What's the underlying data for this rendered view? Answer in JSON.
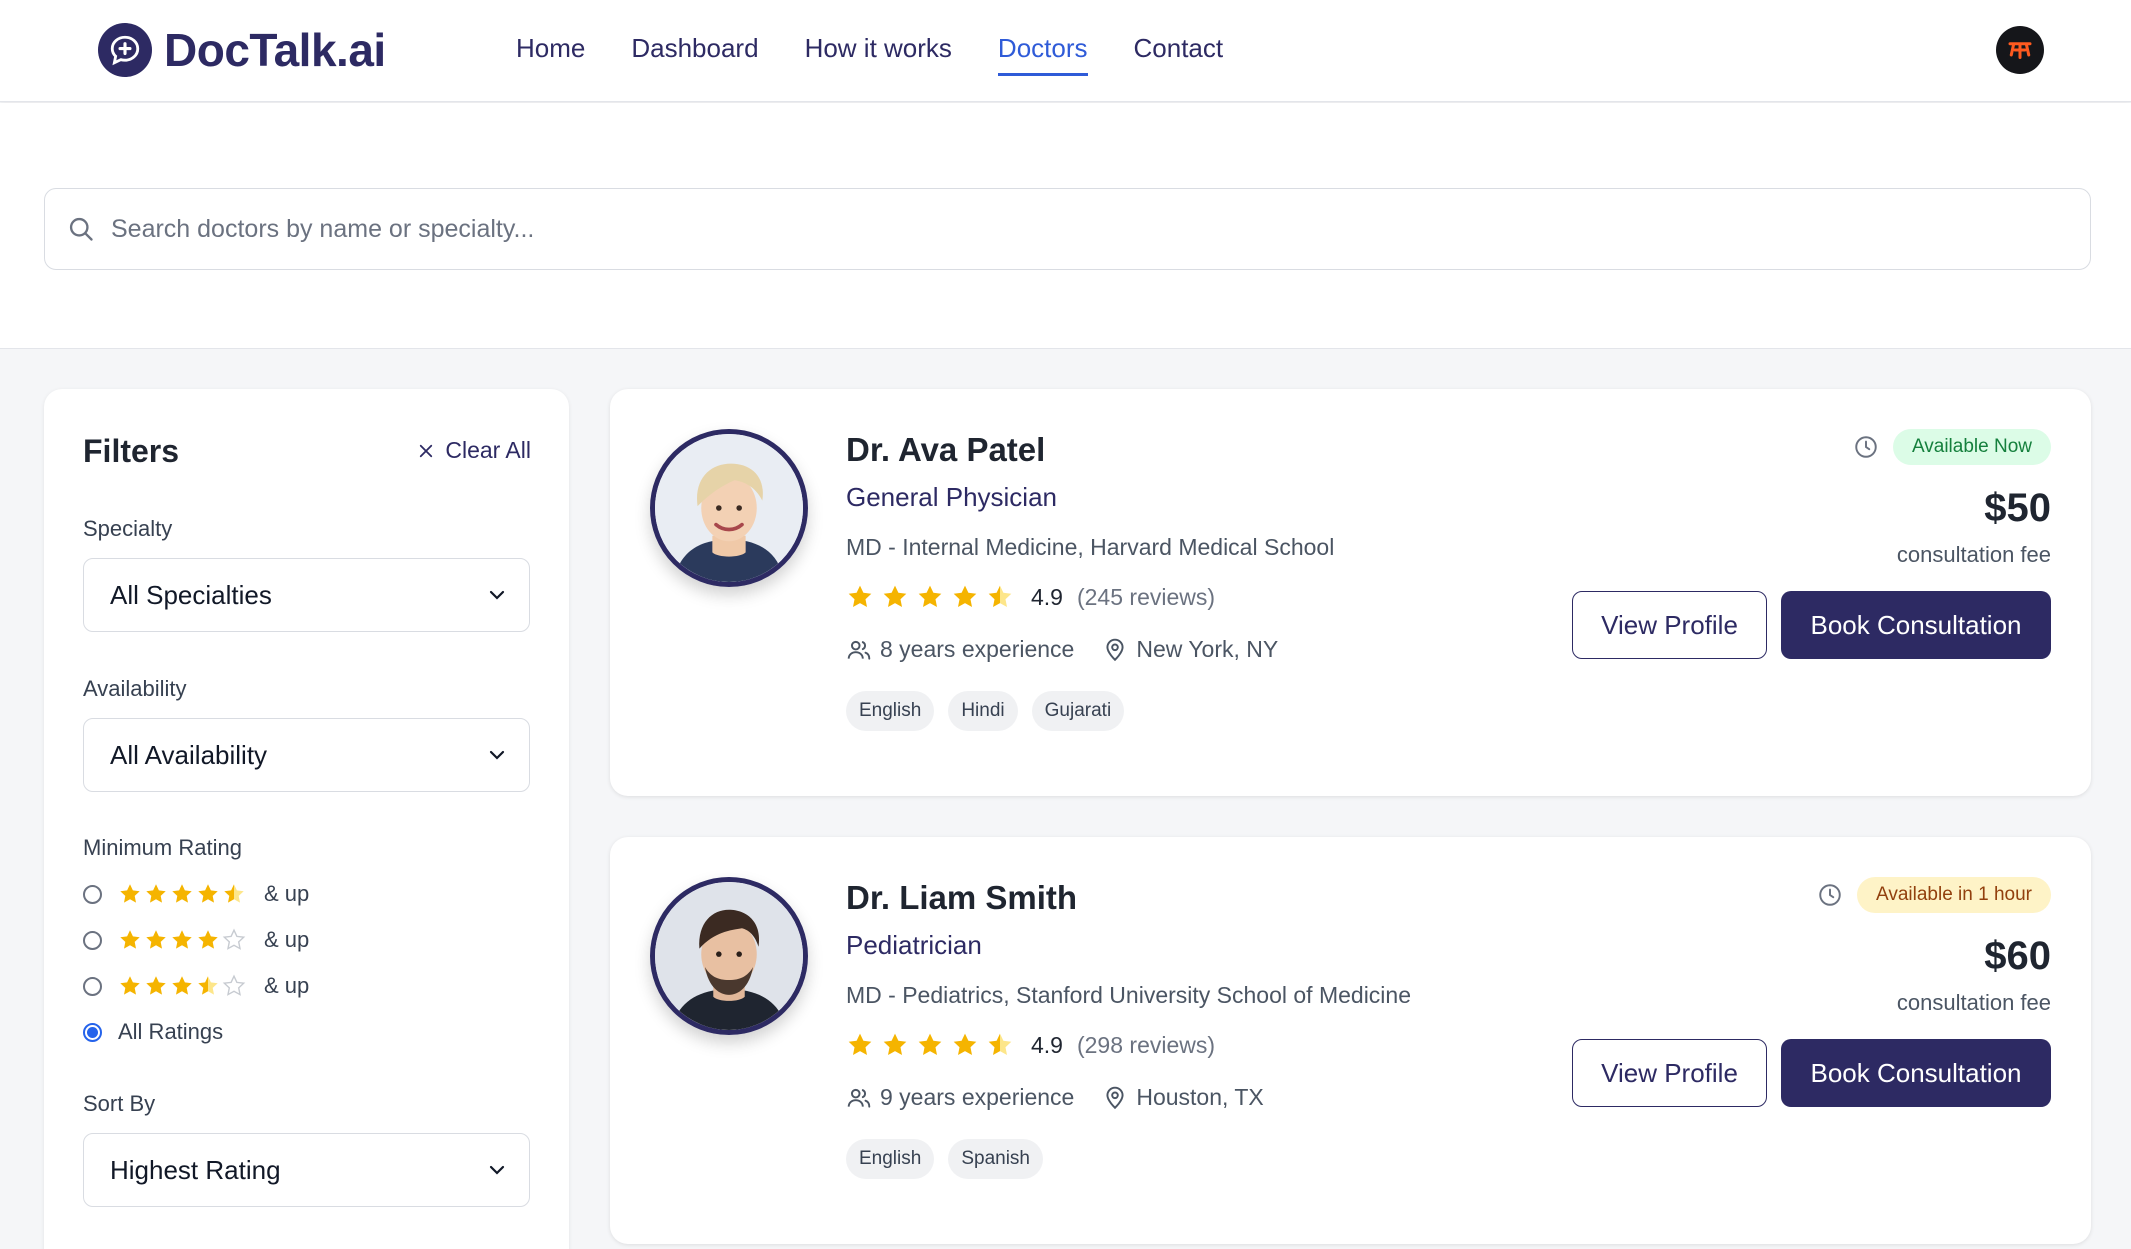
{
  "header": {
    "logo_text": "DocTalk.ai",
    "nav": [
      "Home",
      "Dashboard",
      "How it works",
      "Doctors",
      "Contact"
    ],
    "active_nav": "Doctors",
    "accent_color": "#2f5bd8",
    "brand_color": "#2d2a63"
  },
  "search": {
    "placeholder": "Search doctors by name or specialty..."
  },
  "filters": {
    "title": "Filters",
    "clear_all": "Clear All",
    "specialty_label": "Specialty",
    "specialty_value": "All Specialties",
    "availability_label": "Availability",
    "availability_value": "All Availability",
    "min_rating_label": "Minimum Rating",
    "rating_options": [
      {
        "stars": 4.5,
        "label": "& up",
        "checked": false
      },
      {
        "stars": 4,
        "label": "& up",
        "checked": false
      },
      {
        "stars": 3.5,
        "label": "& up",
        "checked": false
      },
      {
        "label": "All Ratings",
        "checked": true
      }
    ],
    "sort_label": "Sort By",
    "sort_value": "Highest Rating"
  },
  "doctors": [
    {
      "name": "Dr. Ava Patel",
      "specialty": "General Physician",
      "education": "MD - Internal Medicine, Harvard Medical School",
      "rating": "4.9",
      "stars": 4.5,
      "reviews": "(245 reviews)",
      "experience": "8 years experience",
      "location": "New York, NY",
      "languages": [
        "English",
        "Hindi",
        "Gujarati"
      ],
      "availability": "Available Now",
      "availability_status": "now",
      "fee": "$50",
      "fee_label": "consultation fee",
      "view_profile": "View Profile",
      "book": "Book Consultation"
    },
    {
      "name": "Dr. Liam Smith",
      "specialty": "Pediatrician",
      "education": "MD - Pediatrics, Stanford University School of Medicine",
      "rating": "4.9",
      "stars": 4.5,
      "reviews": "(298 reviews)",
      "experience": "9 years experience",
      "location": "Houston, TX",
      "languages": [
        "English",
        "Spanish"
      ],
      "availability": "Available in 1 hour",
      "availability_status": "soon",
      "fee": "$60",
      "fee_label": "consultation fee",
      "view_profile": "View Profile",
      "book": "Book Consultation"
    }
  ]
}
